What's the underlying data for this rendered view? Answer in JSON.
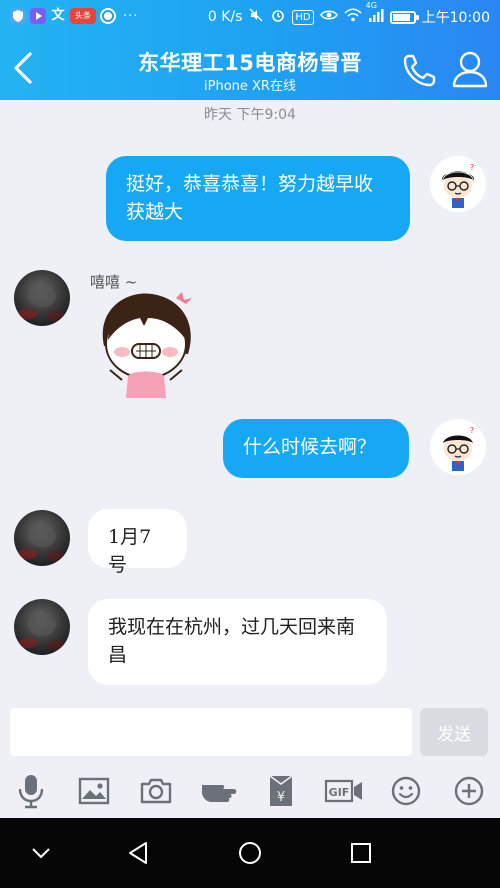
{
  "status_bar": {
    "app_icons": [
      "shield-icon",
      "video-app-icon",
      "translate-app-icon",
      "toutiao-app-icon",
      "browser-app-icon"
    ],
    "toutiao_label": "头条",
    "more_indicator": "···",
    "network_speed": "0 K/s",
    "network_type": "4G",
    "hd_badge": "HD",
    "time": "上午10:00",
    "battery_level": 0.85
  },
  "header": {
    "title": "东华理工15电商杨雪晋",
    "subtitle": "iPhone XR在线"
  },
  "chat": {
    "timestamp": "昨天 下午9:04",
    "messages": [
      {
        "direction": "out",
        "type": "text",
        "text": "挺好，恭喜恭喜！努力越早收获越大"
      },
      {
        "direction": "in",
        "type": "sticker",
        "sender_name": "嘻嘻 ~",
        "sticker": "cartoon-girl-smiling"
      },
      {
        "direction": "out",
        "type": "text",
        "text": "什么时候去啊？"
      },
      {
        "direction": "in",
        "type": "text",
        "text": "1月7号"
      },
      {
        "direction": "in",
        "type": "text",
        "text": "我现在在杭州，过几天回来南昌"
      }
    ]
  },
  "input": {
    "value": "",
    "placeholder": "",
    "send_label": "发送"
  },
  "toolbar": {
    "items": [
      "microphone-icon",
      "image-icon",
      "camera-icon",
      "poke-hand-icon",
      "red-packet-icon",
      "gif-icon",
      "emoji-icon",
      "plus-icon"
    ],
    "red_packet_symbol": "¥",
    "gif_label": "GIF"
  },
  "colors": {
    "header_blue": "#1ea1f2",
    "outgoing_bubble": "#16a7f5",
    "chat_bg": "#eef0f5"
  }
}
